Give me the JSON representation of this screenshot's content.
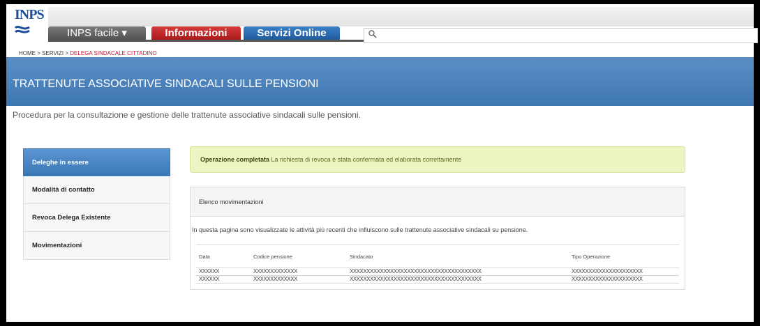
{
  "header": {
    "logo_text": "INPS",
    "tabs": [
      {
        "label": "INPS facile  ▾"
      },
      {
        "label": "Informazioni"
      },
      {
        "label": "Servizi Online"
      }
    ],
    "search_placeholder": ""
  },
  "breadcrumb": {
    "home": "HOME",
    "servizi": "SERVIZI",
    "current": "DELEGA SINDACALE CITTADINO",
    "separator": ">"
  },
  "banner": {
    "title": "TRATTENUTE ASSOCIATIVE SINDACALI SULLE PENSIONI"
  },
  "subtitle": "Procedura per la consultazione e gestione delle trattenute associative sindacali sulle pensioni.",
  "sidebar": {
    "items": [
      {
        "label": "Deleghe in essere"
      },
      {
        "label": "Modalità di contatto"
      },
      {
        "label": "Revoca Delega Existente"
      },
      {
        "label": "Movimentazioni"
      }
    ]
  },
  "alert": {
    "strong": "Operazione completata",
    "message": "La richiesta di revoca è stata confermata ed elaborata correttamente"
  },
  "panel": {
    "title": "Elenco movimentazioni",
    "description": "In questa pagina sono visualizzate le attività più recenti che influiscono sulle trattenute associative sindacali su pensione.",
    "columns": [
      "Data",
      "Codice pensione",
      "Sindacato",
      "Tipo Operazione"
    ],
    "rows": [
      [
        "XXXXXX",
        "XXXXXXXXXXXXX",
        "XXXXXXXXXXXXXXXXXXXXXXXXXXXXXXXXXXXXXXX",
        "XXXXXXXXXXXXXXXXXXXXX"
      ],
      [
        "XXXXXX",
        "XXXXXXXXXXXXX",
        "XXXXXXXXXXXXXXXXXXXXXXXXXXXXXXXXXXXXXXX",
        "XXXXXXXXXXXXXXXXXXXXX"
      ]
    ]
  },
  "colors": {
    "banner": "#4a83bf",
    "tab_info": "#c02424",
    "tab_servizi": "#2a67ad",
    "alert_bg": "#eef5c2",
    "breadcrumb_active": "#c8102e"
  }
}
